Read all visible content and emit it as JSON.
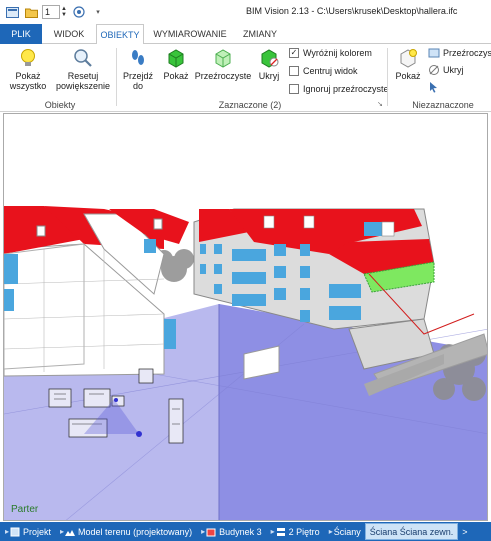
{
  "window": {
    "title": "BIM Vision 2.13 - C:\\Users\\krusek\\Desktop\\hallera.ifc",
    "quick_access_value": "1"
  },
  "tabs": [
    {
      "label": "PLIK"
    },
    {
      "label": "WIDOK"
    },
    {
      "label": "OBIEKTY"
    },
    {
      "label": "WYMIAROWANIE"
    },
    {
      "label": "ZMIANY"
    }
  ],
  "ribbon": {
    "groups": {
      "obiekty": "Obiekty",
      "zaznaczone": "Zaznaczone (2)",
      "niezaznaczone": "Niezaznaczone"
    },
    "buttons": {
      "pokaz_wszystko_1": "Pokaż",
      "pokaz_wszystko_2": "wszystko",
      "resetuj_1": "Resetuj",
      "resetuj_2": "powiększenie",
      "przejdz_1": "Przejdź",
      "przejdz_2": "do",
      "pokaz": "Pokaż",
      "przezroczyste": "Przeźroczyste",
      "ukryj": "Ukryj",
      "pokaz_niezazn": "Pokaż"
    },
    "checkboxes": [
      {
        "label": "Wyróżnij kolorem",
        "checked": true
      },
      {
        "label": "Centruj widok",
        "checked": false
      },
      {
        "label": "Ignoruj przeźroczyste",
        "checked": false
      }
    ],
    "niezaznaczone_items": {
      "przezroczyste": "Przeźroczyste",
      "ukryj": "Ukryj"
    }
  },
  "viewport": {
    "floor_label": "Parter"
  },
  "statusbar": {
    "crumbs": [
      {
        "label": "Projekt"
      },
      {
        "label": "Model terenu  (projektowany)"
      },
      {
        "label": "Budynek 3"
      },
      {
        "label": "2 Piętro"
      },
      {
        "label": "Ściany"
      },
      {
        "label": "Ściana Ściana zewn."
      }
    ],
    "more": ">"
  },
  "colors": {
    "accent": "#1e67b8",
    "roof": "#e8121c",
    "glass": "#4aa6de",
    "highlight": "#7ee860",
    "floor_plane": "#9a9be8"
  }
}
